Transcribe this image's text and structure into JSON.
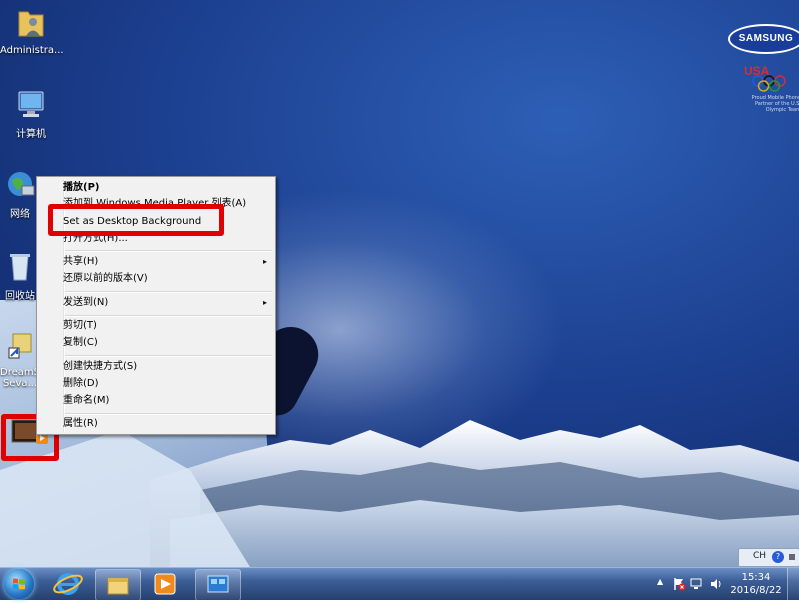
{
  "desktop": {
    "brand_text": "SAMSUNG",
    "olympic_text": "USA",
    "sponsor_text": "Proud Mobile Phone Partner of the U.S. Olympic Team",
    "icons": [
      {
        "label": "Administra..."
      },
      {
        "label": "计算机"
      },
      {
        "label": "网络"
      },
      {
        "label": "回收站"
      },
      {
        "label": "DreamS... Seva..."
      },
      {
        "label": ""
      }
    ]
  },
  "context_menu": {
    "items": [
      {
        "label": "播放(P)"
      },
      {
        "label": "添加到 Windows Media Player 列表(A)"
      },
      {
        "label": "Set as Desktop Background"
      },
      {
        "label": "打开方式(H)..."
      },
      {
        "label": "共享(H)"
      },
      {
        "label": "还原以前的版本(V)"
      },
      {
        "label": "发送到(N)"
      },
      {
        "label": "剪切(T)"
      },
      {
        "label": "复制(C)"
      },
      {
        "label": "创建快捷方式(S)"
      },
      {
        "label": "删除(D)"
      },
      {
        "label": "重命名(M)"
      },
      {
        "label": "属性(R)"
      }
    ],
    "submenu_arrow": "▸"
  },
  "language_bar": {
    "code": "CH",
    "help": "?"
  },
  "taskbar": {
    "time": "15:34",
    "date": "2016/8/22"
  },
  "colors": {
    "highlight": "#e00000",
    "taskbar_top": "#6a8fc4",
    "menu_bg": "#f1f1f1"
  }
}
